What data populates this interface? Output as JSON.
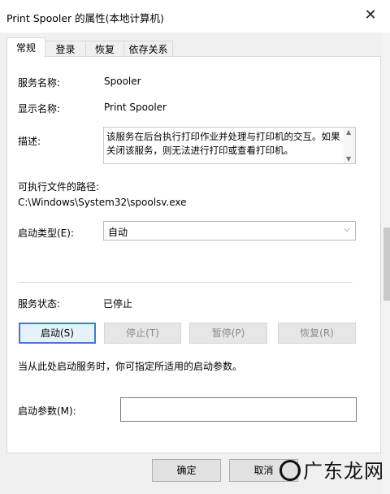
{
  "window": {
    "title": "Print Spooler 的属性(本地计算机)"
  },
  "tabs": [
    {
      "label": "常规"
    },
    {
      "label": "登录"
    },
    {
      "label": "恢复"
    },
    {
      "label": "依存关系"
    }
  ],
  "general": {
    "service_name_label": "服务名称:",
    "service_name": "Spooler",
    "display_name_label": "显示名称:",
    "display_name": "Print Spooler",
    "description_label": "描述:",
    "description": "该服务在后台执行打印作业并处理与打印机的交互。如果关闭该服务，则无法进行打印或查看打印机。",
    "path_label": "可执行文件的路径:",
    "path": "C:\\Windows\\System32\\spoolsv.exe",
    "startup_type_label": "启动类型(E):",
    "startup_type": "自动",
    "status_label": "服务状态:",
    "status": "已停止",
    "buttons": {
      "start": "启动(S)",
      "stop": "停止(T)",
      "pause": "暂停(P)",
      "resume": "恢复(R)"
    },
    "hint": "当从此处启动服务时，你可指定所适用的启动参数。",
    "params_label": "启动参数(M):",
    "params_value": ""
  },
  "footer": {
    "ok": "确定",
    "cancel": "取消"
  },
  "watermark": {
    "text": "广东龙网"
  },
  "colors": {
    "accent": "#3d7ad6",
    "disabled_text": "#8a8a8a"
  }
}
